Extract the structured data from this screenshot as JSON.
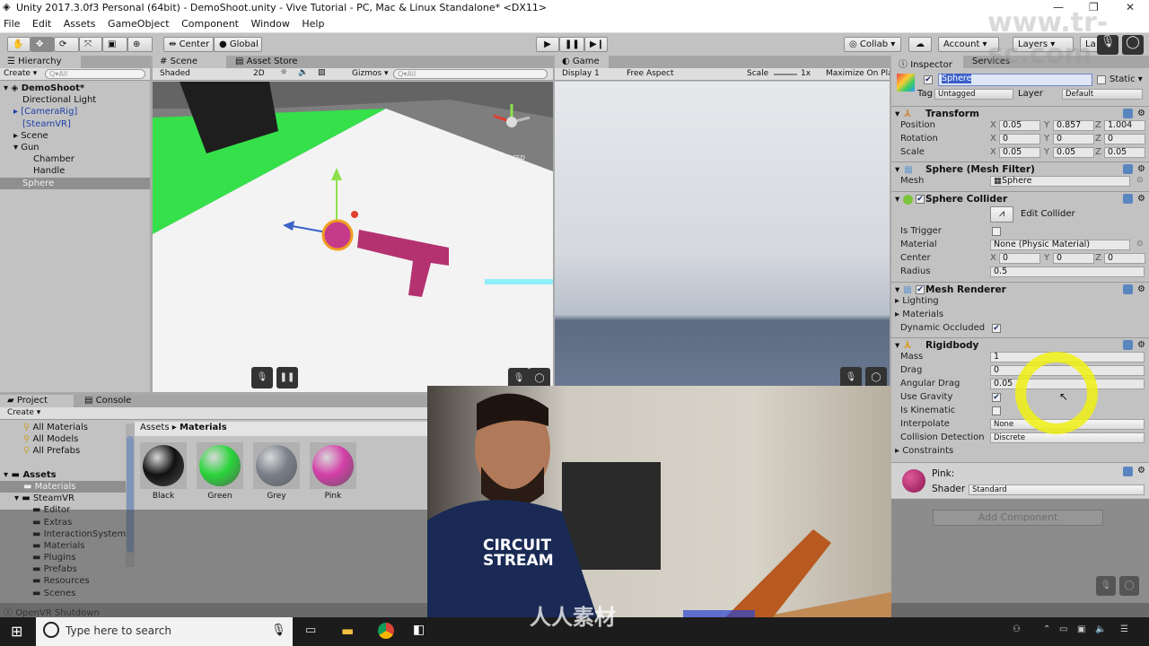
{
  "window": {
    "title": "Unity 2017.3.0f3 Personal (64bit) - DemoShoot.unity - Vive Tutorial - PC, Mac & Linux Standalone* <DX11>",
    "minimize": "—",
    "restore": "❐",
    "close": "✕"
  },
  "menu": [
    "File",
    "Edit",
    "Assets",
    "GameObject",
    "Component",
    "Window",
    "Help"
  ],
  "toolbar": {
    "tools": [
      "hand-tool",
      "move-tool",
      "rotate-tool",
      "scale-tool",
      "rect-tool",
      "transform-tool"
    ],
    "pivot": "Center",
    "space": "Global",
    "collab": "Collab ▾",
    "account": "Account ▾",
    "layers": "Layers ▾",
    "layout": "La"
  },
  "hierarchy": {
    "tab": "Hierarchy",
    "create": "Create ▾",
    "search_placeholder": "Q▾All",
    "scene": "DemoShoot*",
    "items": [
      {
        "label": "Directional Light"
      },
      {
        "label": "[CameraRig]"
      },
      {
        "label": "[SteamVR]"
      },
      {
        "label": "Scene"
      },
      {
        "label": "Gun"
      },
      {
        "label": "Chamber"
      },
      {
        "label": "Handle"
      },
      {
        "label": "Sphere"
      }
    ]
  },
  "scene": {
    "tabs": [
      "Scene",
      "Asset Store"
    ],
    "shading": "Shaded",
    "mode2d": "2D",
    "gizmos": "Gizmos ▾",
    "search_placeholder": "Q▾All",
    "persp": "< Persp"
  },
  "game": {
    "tab": "Game",
    "display": "Display 1",
    "aspect": "Free Aspect",
    "scale_label": "Scale",
    "scale_value": "1x",
    "maximize": "Maximize On Pla"
  },
  "inspector": {
    "tabs": [
      "Inspector",
      "Services"
    ],
    "name": "Sphere",
    "static": "Static",
    "tag_label": "Tag",
    "tag": "Untagged",
    "layer_label": "Layer",
    "layer": "Default",
    "transform": {
      "title": "Transform",
      "position_label": "Position",
      "rotation_label": "Rotation",
      "scale_label": "Scale",
      "position": [
        "0.05",
        "0.857",
        "1.004"
      ],
      "rotation": [
        "0",
        "0",
        "0"
      ],
      "scale": [
        "0.05",
        "0.05",
        "0.05"
      ]
    },
    "mesh_filter": {
      "title": "Sphere (Mesh Filter)",
      "mesh_label": "Mesh",
      "mesh": "Sphere"
    },
    "collider": {
      "title": "Sphere Collider",
      "edit": "Edit Collider",
      "is_trigger": "Is Trigger",
      "material_label": "Material",
      "material": "None (Physic Material)",
      "center_label": "Center",
      "center": [
        "0",
        "0",
        "0"
      ],
      "radius_label": "Radius",
      "radius": "0.5"
    },
    "mesh_renderer": {
      "title": "Mesh Renderer",
      "lighting": "Lighting",
      "materials": "Materials",
      "dynamic_occluded": "Dynamic Occluded"
    },
    "rigidbody": {
      "title": "Rigidbody",
      "mass_label": "Mass",
      "mass": "1",
      "drag_label": "Drag",
      "drag": "0",
      "angular_drag_label": "Angular Drag",
      "angular_drag": "0.05",
      "use_gravity": "Use Gravity",
      "is_kinematic": "Is Kinematic",
      "interpolate_label": "Interpolate",
      "interpolate": "None",
      "collision_label": "Collision Detection",
      "collision": "Discrete",
      "constraints": "Constraints"
    },
    "material": {
      "name": "Pink:",
      "shader_label": "Shader",
      "shader": "Standard"
    },
    "add_component": "Add Component"
  },
  "project": {
    "tabs": [
      "Project",
      "Console"
    ],
    "create": "Create ▾",
    "favorites": [
      "All Materials",
      "All Models",
      "All Prefabs"
    ],
    "assets": "Assets",
    "tree": [
      "Materials",
      "SteamVR",
      "Editor",
      "Extras",
      "InteractionSystem",
      "Materials",
      "Plugins",
      "Prefabs",
      "Resources",
      "Scenes"
    ],
    "breadcrumb": [
      "Assets",
      "Materials"
    ],
    "materials": [
      {
        "name": "Black",
        "color": "#111111"
      },
      {
        "name": "Green",
        "color": "#2ad43a"
      },
      {
        "name": "Grey",
        "color": "#7a808a"
      },
      {
        "name": "Pink",
        "color": "#d43fa8"
      }
    ]
  },
  "status": "OpenVR Shutdown",
  "taskbar": {
    "search_placeholder": "Type here to search"
  },
  "webcam": {
    "shirt": "CIRCUIT STREAM"
  },
  "watermark": {
    "site": "www.tr-sc.com",
    "brand": "人人素材"
  }
}
